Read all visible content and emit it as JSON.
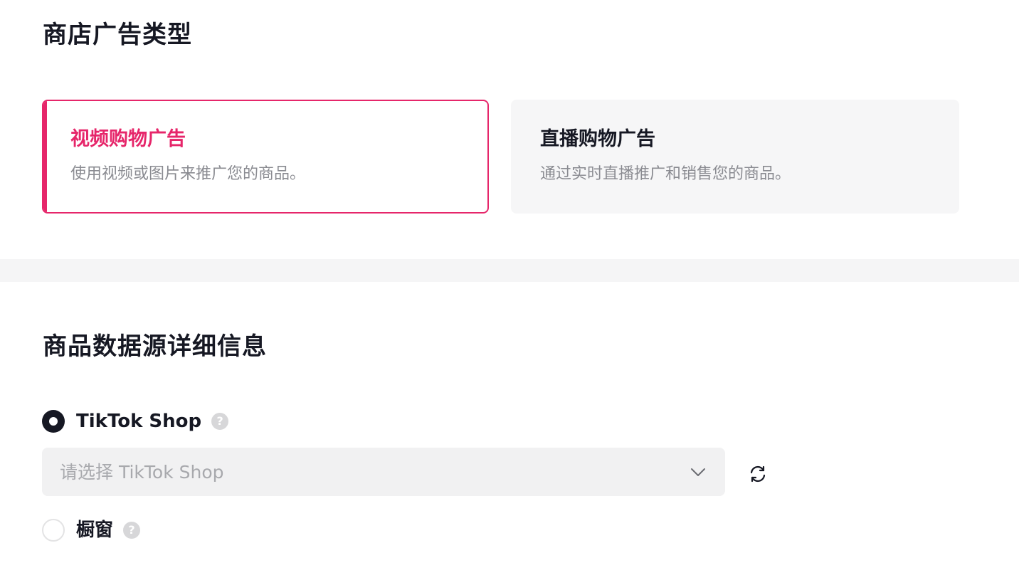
{
  "shop_ad_type": {
    "title": "商店广告类型",
    "cards": [
      {
        "title": "视频购物广告",
        "description": "使用视频或图片来推广您的商品。",
        "selected": true
      },
      {
        "title": "直播购物广告",
        "description": "通过实时直播推广和销售您的商品。",
        "selected": false
      }
    ]
  },
  "product_source": {
    "title": "商品数据源详细信息",
    "options": [
      {
        "label": "TikTok Shop",
        "checked": true,
        "help_icon": "question-circle-icon"
      },
      {
        "label": "橱窗",
        "checked": false,
        "help_icon": "question-circle-icon"
      }
    ],
    "shop_select": {
      "placeholder": "请选择 TikTok Shop",
      "icon": "chevron-down-icon"
    },
    "refresh_icon": "refresh-icon"
  },
  "colors": {
    "accent": "#e6266a",
    "text_primary": "#161823",
    "text_secondary": "#8a8b91",
    "card_bg_unselected": "#f6f6f7",
    "select_bg": "#f1f1f2"
  }
}
